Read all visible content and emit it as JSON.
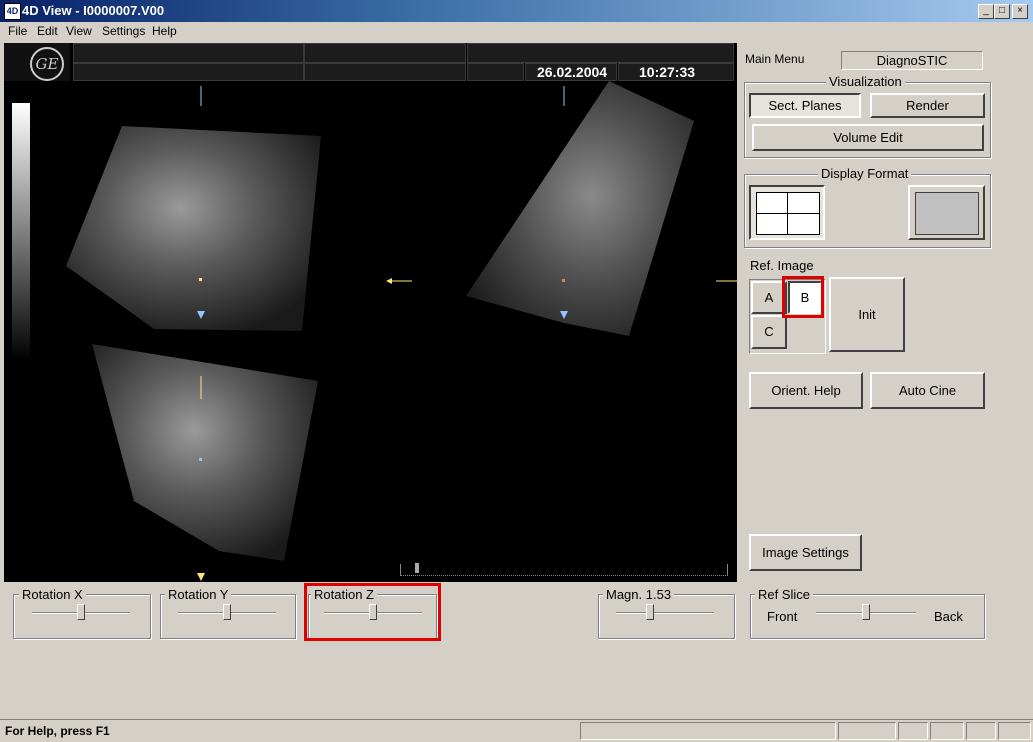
{
  "window": {
    "title": "4D View - I0000007.V00",
    "controls": {
      "minimize": "_",
      "maximize": "□",
      "close": "×"
    }
  },
  "menu": [
    "File",
    "Edit",
    "View",
    "Settings",
    "Help"
  ],
  "image_header": {
    "logo": "GE",
    "date": "26.02.2004",
    "time": "10:27:33"
  },
  "panel": {
    "main_menu_label": "Main Menu",
    "main_menu_value": "DiagnoSTIC",
    "visualization": {
      "label": "Visualization",
      "sect_planes": "Sect. Planes",
      "render": "Render",
      "volume_edit": "Volume Edit"
    },
    "display_format": {
      "label": "Display Format"
    },
    "ref_image": {
      "label": "Ref. Image",
      "a": "A",
      "b": "B",
      "c": "C",
      "init": "Init",
      "selected": "B"
    },
    "orient_help": "Orient. Help",
    "auto_cine": "Auto Cine",
    "image_settings": "Image Settings"
  },
  "sliders": {
    "rotation_x": {
      "label": "Rotation X",
      "value": 0.5
    },
    "rotation_y": {
      "label": "Rotation Y",
      "value": 0.5
    },
    "rotation_z": {
      "label": "Rotation Z",
      "value": 0.5
    },
    "magn": {
      "label": "Magn. 1.53",
      "value": 0.35
    },
    "ref_slice": {
      "label": "Ref Slice",
      "left": "Front",
      "right": "Back",
      "value": 0.5
    }
  },
  "status": {
    "help_text": "For Help, press F1"
  },
  "colors": {
    "highlight": "#e00000",
    "title_bar": "#0a246a"
  }
}
